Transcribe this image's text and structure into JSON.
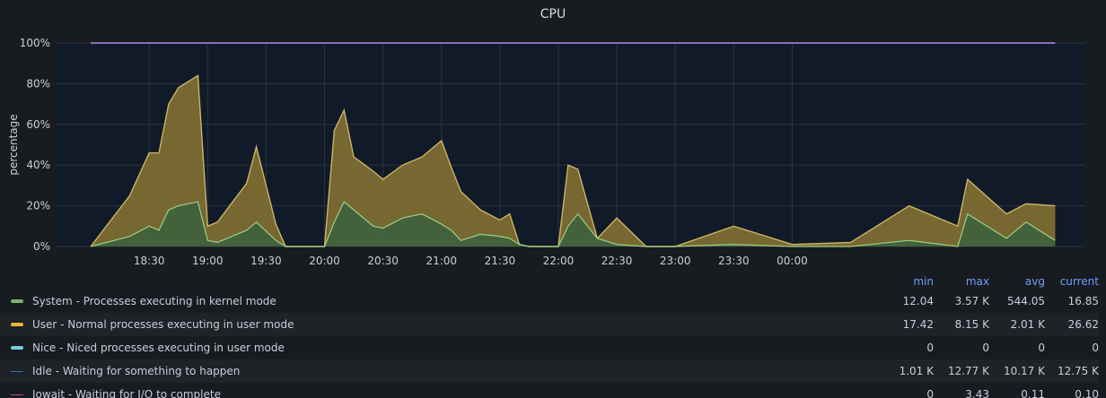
{
  "panel": {
    "title": "CPU"
  },
  "colors": {
    "system": "#7eb26d",
    "user": "#eab839",
    "nice": "#6ed0e0",
    "idle": "#1f78c1",
    "iowait": "#ba43a9",
    "accent": "#6e9fff"
  },
  "chart_data": {
    "type": "area",
    "stacked": true,
    "title": "CPU",
    "ylabel": "percentage",
    "ylim": [
      0,
      100
    ],
    "y_ticks": [
      "0%",
      "20%",
      "40%",
      "60%",
      "80%",
      "100%"
    ],
    "x_tick_labels": [
      "18:30",
      "19:00",
      "19:30",
      "20:00",
      "20:30",
      "21:00",
      "21:30",
      "22:00",
      "22:30",
      "23:00",
      "23:30",
      "00:00"
    ],
    "x_minutes": [
      1080,
      1100,
      1110,
      1115,
      1120,
      1125,
      1135,
      1140,
      1145,
      1160,
      1165,
      1175,
      1180,
      1190,
      1200,
      1205,
      1210,
      1215,
      1225,
      1230,
      1240,
      1250,
      1260,
      1265,
      1270,
      1280,
      1290,
      1295,
      1300,
      1305,
      1310,
      1320,
      1325,
      1330,
      1340,
      1350,
      1365,
      1380,
      1410,
      1440,
      1470,
      1500,
      1525,
      1530,
      1550,
      1560,
      1575
    ],
    "grid": true,
    "series": [
      {
        "name": "System - Processes executing in kernel mode",
        "values": [
          0,
          5,
          10,
          8,
          18,
          20,
          22,
          3,
          2,
          8,
          12,
          3,
          0,
          0,
          0,
          12,
          22,
          18,
          10,
          9,
          14,
          16,
          11,
          8,
          3,
          6,
          5,
          4,
          1,
          0,
          0,
          0,
          10,
          16,
          4,
          1,
          0,
          0,
          1,
          0,
          0,
          3,
          0,
          16,
          4,
          12,
          3
        ]
      },
      {
        "name": "User - Normal processes executing in user mode",
        "values": [
          0,
          20,
          36,
          38,
          52,
          58,
          62,
          7,
          10,
          23,
          37,
          8,
          0,
          0,
          0,
          45,
          45,
          26,
          27,
          24,
          26,
          28,
          41,
          31,
          24,
          12,
          8,
          12,
          0,
          0,
          0,
          0,
          30,
          22,
          0,
          13,
          0,
          0,
          9,
          1,
          2,
          17,
          10,
          17,
          12,
          9,
          17
        ]
      },
      {
        "name": "Nice - Niced processes executing in user mode",
        "values": [
          0,
          0,
          0,
          0,
          0,
          0,
          0,
          0,
          0,
          0,
          0,
          0,
          0,
          0,
          0,
          0,
          0,
          0,
          0,
          0,
          0,
          0,
          0,
          0,
          0,
          0,
          0,
          0,
          0,
          0,
          0,
          0,
          0,
          0,
          0,
          0,
          0,
          0,
          0,
          0,
          0,
          0,
          0,
          0,
          0,
          0,
          0
        ]
      },
      {
        "name": "Idle - Waiting for something to happen",
        "values": [
          100,
          75,
          54,
          54,
          30,
          22,
          16,
          90,
          88,
          69,
          51,
          89,
          100,
          100,
          100,
          43,
          33,
          56,
          63,
          67,
          60,
          56,
          48,
          61,
          73,
          82,
          87,
          84,
          99,
          100,
          100,
          100,
          60,
          62,
          96,
          86,
          100,
          100,
          90,
          99,
          98,
          80,
          90,
          67,
          84,
          79,
          80
        ]
      }
    ]
  },
  "legend": {
    "headers": {
      "min": "min",
      "max": "max",
      "avg": "avg",
      "current": "current"
    },
    "rows": [
      {
        "name": "System - Processes executing in kernel mode",
        "min": "12.04",
        "max": "3.57 K",
        "avg": "544.05",
        "current": "16.85"
      },
      {
        "name": "User - Normal processes executing in user mode",
        "min": "17.42",
        "max": "8.15 K",
        "avg": "2.01 K",
        "current": "26.62"
      },
      {
        "name": "Nice - Niced processes executing in user mode",
        "min": "0",
        "max": "0",
        "avg": "0",
        "current": "0"
      },
      {
        "name": "Idle - Waiting for something to happen",
        "min": "1.01 K",
        "max": "12.77 K",
        "avg": "10.17 K",
        "current": "12.75 K"
      }
    ],
    "clipped_row": {
      "name": "Iowait - Waiting for I/O to complete",
      "min": "0",
      "max": "3.43",
      "avg": "0.11",
      "current": "0.10"
    }
  }
}
